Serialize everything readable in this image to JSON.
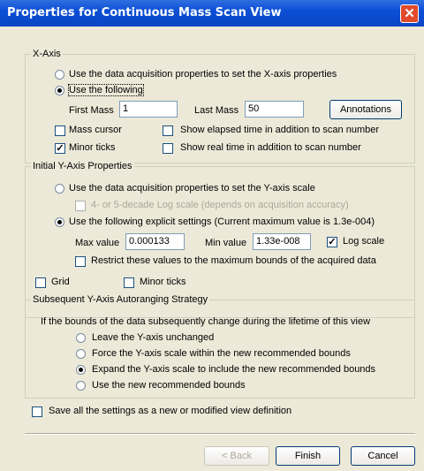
{
  "title": "Properties for Continuous Mass Scan View",
  "close_glyph": "✕",
  "xaxis": {
    "legend": "X-Axis",
    "radio_acq": "Use the data acquisition properties to set the X-axis properties",
    "radio_following": "Use the following",
    "first_mass_label": "First Mass",
    "first_mass_value": "1",
    "last_mass_label": "Last Mass",
    "last_mass_value": "50",
    "annotations_button": "Annotations",
    "mass_cursor": "Mass cursor",
    "show_elapsed": "Show elapsed time in addition to scan number",
    "minor_ticks": "Minor ticks",
    "show_real": "Show real time in addition to scan number"
  },
  "yaxis": {
    "legend": "Initial Y-Axis Properties",
    "radio_acq": "Use the data acquisition properties to set the Y-axis scale",
    "log_decade": "4- or 5-decade Log scale (depends on acquisition accuracy)",
    "radio_explicit": "Use the following explicit settings  (Current maximum value is 1.3e-004)",
    "max_label": "Max value",
    "max_value": "0.000133",
    "min_label": "Min value",
    "min_value": "1.33e-008",
    "log_scale": "Log scale",
    "restrict": "Restrict these values to the maximum bounds of the acquired data",
    "grid": "Grid",
    "minor_ticks": "Minor ticks"
  },
  "autorange": {
    "legend": "Subsequent Y-Axis Autoranging Strategy",
    "intro": "If the bounds of the data subsequently change during the lifetime of this view",
    "opt1": "Leave the Y-axis unchanged",
    "opt2": "Force the Y-axis scale within the new recommended bounds",
    "opt3": "Expand the Y-axis scale to include the new recommended bounds",
    "opt4": "Use the new recommended bounds"
  },
  "save_settings": "Save all the settings as a new or modified view definition",
  "buttons": {
    "back": "< Back",
    "finish": "Finish",
    "cancel": "Cancel"
  },
  "colors": {
    "title_bar": "#0b4fd6",
    "dialog_bg": "#ece9d8",
    "close_button": "#e04a2a"
  }
}
